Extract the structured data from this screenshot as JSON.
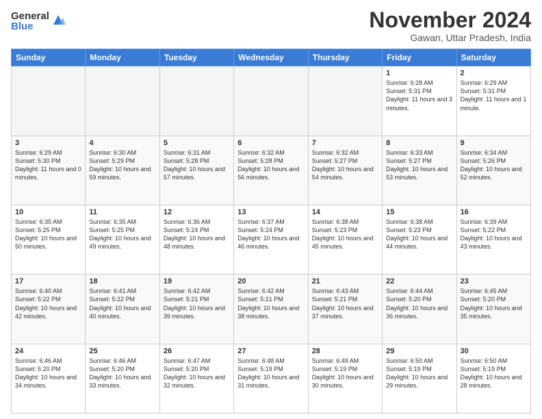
{
  "logo": {
    "general": "General",
    "blue": "Blue"
  },
  "header": {
    "month": "November 2024",
    "location": "Gawan, Uttar Pradesh, India"
  },
  "weekdays": [
    "Sunday",
    "Monday",
    "Tuesday",
    "Wednesday",
    "Thursday",
    "Friday",
    "Saturday"
  ],
  "weeks": [
    [
      {
        "day": "",
        "info": ""
      },
      {
        "day": "",
        "info": ""
      },
      {
        "day": "",
        "info": ""
      },
      {
        "day": "",
        "info": ""
      },
      {
        "day": "",
        "info": ""
      },
      {
        "day": "1",
        "info": "Sunrise: 6:28 AM\nSunset: 5:31 PM\nDaylight: 11 hours and 3 minutes."
      },
      {
        "day": "2",
        "info": "Sunrise: 6:29 AM\nSunset: 5:31 PM\nDaylight: 11 hours and 1 minute."
      }
    ],
    [
      {
        "day": "3",
        "info": "Sunrise: 6:29 AM\nSunset: 5:30 PM\nDaylight: 11 hours and 0 minutes."
      },
      {
        "day": "4",
        "info": "Sunrise: 6:30 AM\nSunset: 5:29 PM\nDaylight: 10 hours and 59 minutes."
      },
      {
        "day": "5",
        "info": "Sunrise: 6:31 AM\nSunset: 5:28 PM\nDaylight: 10 hours and 57 minutes."
      },
      {
        "day": "6",
        "info": "Sunrise: 6:32 AM\nSunset: 5:28 PM\nDaylight: 10 hours and 56 minutes."
      },
      {
        "day": "7",
        "info": "Sunrise: 6:32 AM\nSunset: 5:27 PM\nDaylight: 10 hours and 54 minutes."
      },
      {
        "day": "8",
        "info": "Sunrise: 6:33 AM\nSunset: 5:27 PM\nDaylight: 10 hours and 53 minutes."
      },
      {
        "day": "9",
        "info": "Sunrise: 6:34 AM\nSunset: 5:26 PM\nDaylight: 10 hours and 52 minutes."
      }
    ],
    [
      {
        "day": "10",
        "info": "Sunrise: 6:35 AM\nSunset: 5:25 PM\nDaylight: 10 hours and 50 minutes."
      },
      {
        "day": "11",
        "info": "Sunrise: 6:35 AM\nSunset: 5:25 PM\nDaylight: 10 hours and 49 minutes."
      },
      {
        "day": "12",
        "info": "Sunrise: 6:36 AM\nSunset: 5:24 PM\nDaylight: 10 hours and 48 minutes."
      },
      {
        "day": "13",
        "info": "Sunrise: 6:37 AM\nSunset: 5:24 PM\nDaylight: 10 hours and 46 minutes."
      },
      {
        "day": "14",
        "info": "Sunrise: 6:38 AM\nSunset: 5:23 PM\nDaylight: 10 hours and 45 minutes."
      },
      {
        "day": "15",
        "info": "Sunrise: 6:38 AM\nSunset: 5:23 PM\nDaylight: 10 hours and 44 minutes."
      },
      {
        "day": "16",
        "info": "Sunrise: 6:39 AM\nSunset: 5:22 PM\nDaylight: 10 hours and 43 minutes."
      }
    ],
    [
      {
        "day": "17",
        "info": "Sunrise: 6:40 AM\nSunset: 5:22 PM\nDaylight: 10 hours and 42 minutes."
      },
      {
        "day": "18",
        "info": "Sunrise: 6:41 AM\nSunset: 5:22 PM\nDaylight: 10 hours and 40 minutes."
      },
      {
        "day": "19",
        "info": "Sunrise: 6:42 AM\nSunset: 5:21 PM\nDaylight: 10 hours and 39 minutes."
      },
      {
        "day": "20",
        "info": "Sunrise: 6:42 AM\nSunset: 5:21 PM\nDaylight: 10 hours and 38 minutes."
      },
      {
        "day": "21",
        "info": "Sunrise: 6:43 AM\nSunset: 5:21 PM\nDaylight: 10 hours and 37 minutes."
      },
      {
        "day": "22",
        "info": "Sunrise: 6:44 AM\nSunset: 5:20 PM\nDaylight: 10 hours and 36 minutes."
      },
      {
        "day": "23",
        "info": "Sunrise: 6:45 AM\nSunset: 5:20 PM\nDaylight: 10 hours and 35 minutes."
      }
    ],
    [
      {
        "day": "24",
        "info": "Sunrise: 6:46 AM\nSunset: 5:20 PM\nDaylight: 10 hours and 34 minutes."
      },
      {
        "day": "25",
        "info": "Sunrise: 6:46 AM\nSunset: 5:20 PM\nDaylight: 10 hours and 33 minutes."
      },
      {
        "day": "26",
        "info": "Sunrise: 6:47 AM\nSunset: 5:20 PM\nDaylight: 10 hours and 32 minutes."
      },
      {
        "day": "27",
        "info": "Sunrise: 6:48 AM\nSunset: 5:19 PM\nDaylight: 10 hours and 31 minutes."
      },
      {
        "day": "28",
        "info": "Sunrise: 6:49 AM\nSunset: 5:19 PM\nDaylight: 10 hours and 30 minutes."
      },
      {
        "day": "29",
        "info": "Sunrise: 6:50 AM\nSunset: 5:19 PM\nDaylight: 10 hours and 29 minutes."
      },
      {
        "day": "30",
        "info": "Sunrise: 6:50 AM\nSunset: 5:19 PM\nDaylight: 10 hours and 28 minutes."
      }
    ]
  ]
}
